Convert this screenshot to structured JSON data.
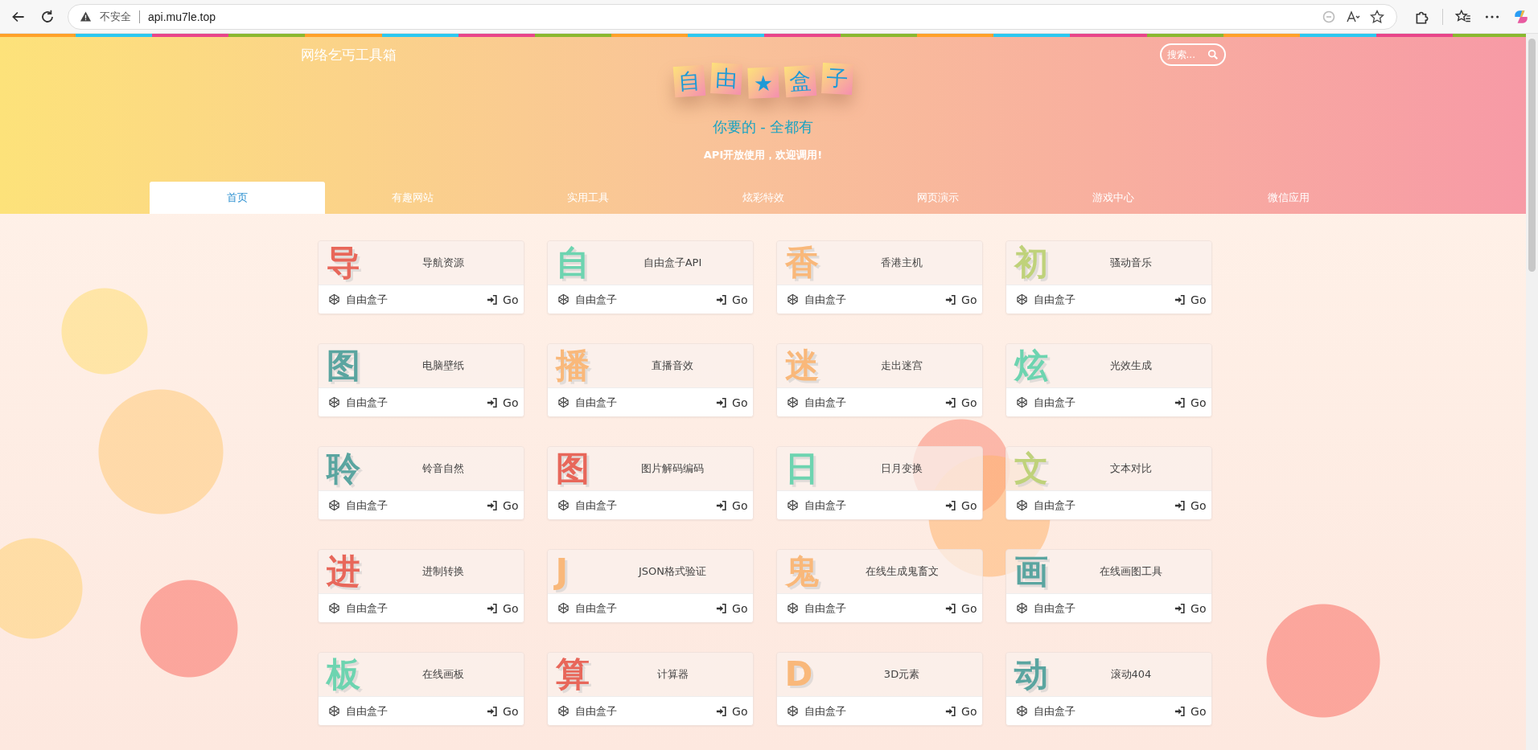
{
  "browser": {
    "security_label": "不安全",
    "url": "api.mu7le.top"
  },
  "header": {
    "site_name": "网络乞丐工具箱",
    "search": {
      "placeholder": "搜索..."
    },
    "logo_tiles": [
      "自",
      "由",
      "★",
      "盒",
      "子"
    ],
    "slogan": "你要的 - 全都有",
    "tagline": "API开放使用，欢迎调用!"
  },
  "tabs": [
    {
      "label": "首页",
      "selected": true
    },
    {
      "label": "有趣网站",
      "selected": false
    },
    {
      "label": "实用工具",
      "selected": false
    },
    {
      "label": "炫彩特效",
      "selected": false
    },
    {
      "label": "网页演示",
      "selected": false
    },
    {
      "label": "游戏中心",
      "selected": false
    },
    {
      "label": "微信应用",
      "selected": false
    }
  ],
  "cards": [
    {
      "glyph": "导",
      "color": "#e8675a",
      "title": "导航资源",
      "source": "自由盒子",
      "action": "Go"
    },
    {
      "glyph": "自",
      "color": "#6dd4b0",
      "title": "自由盒子API",
      "source": "自由盒子",
      "action": "Go"
    },
    {
      "glyph": "香",
      "color": "#f9b87a",
      "title": "香港主机",
      "source": "自由盒子",
      "action": "Go"
    },
    {
      "glyph": "初",
      "color": "#bfd27a",
      "title": "骚动音乐",
      "source": "自由盒子",
      "action": "Go"
    },
    {
      "glyph": "图",
      "color": "#5aa5a0",
      "title": "电脑壁纸",
      "source": "自由盒子",
      "action": "Go"
    },
    {
      "glyph": "播",
      "color": "#f9b87a",
      "title": "直播音效",
      "source": "自由盒子",
      "action": "Go"
    },
    {
      "glyph": "迷",
      "color": "#f9b87a",
      "title": "走出迷宫",
      "source": "自由盒子",
      "action": "Go"
    },
    {
      "glyph": "炫",
      "color": "#6dd4b0",
      "title": "光效生成",
      "source": "自由盒子",
      "action": "Go"
    },
    {
      "glyph": "聆",
      "color": "#5aa5a0",
      "title": "铃音自然",
      "source": "自由盒子",
      "action": "Go"
    },
    {
      "glyph": "图",
      "color": "#e8675a",
      "title": "图片解码编码",
      "source": "自由盒子",
      "action": "Go"
    },
    {
      "glyph": "日",
      "color": "#6dd4b0",
      "title": "日月变换",
      "source": "自由盒子",
      "action": "Go"
    },
    {
      "glyph": "文",
      "color": "#bfd27a",
      "title": "文本对比",
      "source": "自由盒子",
      "action": "Go"
    },
    {
      "glyph": "进",
      "color": "#e8675a",
      "title": "进制转换",
      "source": "自由盒子",
      "action": "Go"
    },
    {
      "glyph": "J",
      "color": "#f9b87a",
      "title": "JSON格式验证",
      "source": "自由盒子",
      "action": "Go"
    },
    {
      "glyph": "鬼",
      "color": "#f9b87a",
      "title": "在线生成鬼畜文",
      "source": "自由盒子",
      "action": "Go"
    },
    {
      "glyph": "画",
      "color": "#5aa5a0",
      "title": "在线画图工具",
      "source": "自由盒子",
      "action": "Go"
    },
    {
      "glyph": "板",
      "color": "#6dd4b0",
      "title": "在线画板",
      "source": "自由盒子",
      "action": "Go"
    },
    {
      "glyph": "算",
      "color": "#e8675a",
      "title": "计算器",
      "source": "自由盒子",
      "action": "Go"
    },
    {
      "glyph": "D",
      "color": "#f9b87a",
      "title": "3D元素",
      "source": "自由盒子",
      "action": "Go"
    },
    {
      "glyph": "动",
      "color": "#5aa5a0",
      "title": "滚动404",
      "source": "自由盒子",
      "action": "Go"
    }
  ]
}
